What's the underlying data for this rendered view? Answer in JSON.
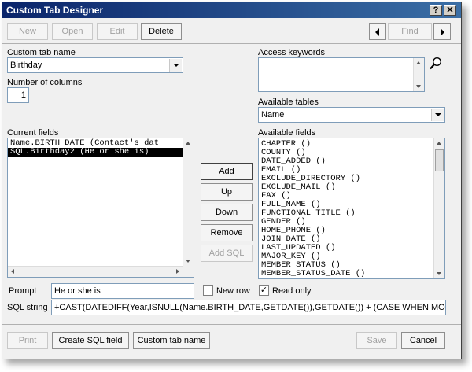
{
  "window": {
    "title": "Custom Tab Designer"
  },
  "titlebar": {
    "help_glyph": "?",
    "close_glyph": "✕"
  },
  "toolbar": {
    "new_label": "New",
    "open_label": "Open",
    "edit_label": "Edit",
    "delete_label": "Delete",
    "find_label": "Find"
  },
  "form": {
    "custom_tab_name_label": "Custom tab name",
    "custom_tab_name_value": "Birthday",
    "number_of_columns_label": "Number of columns",
    "number_of_columns_value": "1",
    "access_keywords_label": "Access keywords",
    "access_keywords_value": "",
    "available_tables_label": "Available tables",
    "available_tables_value": "Name",
    "current_fields_label": "Current fields",
    "available_fields_label": "Available fields",
    "prompt_label": "Prompt",
    "prompt_value": "He or she is",
    "new_row_label": "New row",
    "read_only_label": "Read only",
    "read_only_checked": "✓",
    "sql_string_label": "SQL string",
    "sql_string_value": "+CAST(DATEDIFF(Year,ISNULL(Name.BIRTH_DATE,GETDATE()),GETDATE()) + (CASE WHEN MONTH(G"
  },
  "current_fields": [
    {
      "text": "Name.BIRTH_DATE  (Contact's dat",
      "selected": false
    },
    {
      "text": "SQL.Birthday2  (He or she is)",
      "selected": true
    }
  ],
  "available_fields": [
    "CHAPTER ()",
    "COUNTY ()",
    "DATE_ADDED ()",
    "EMAIL ()",
    "EXCLUDE_DIRECTORY ()",
    "EXCLUDE_MAIL ()",
    "FAX ()",
    "FULL_NAME ()",
    "FUNCTIONAL_TITLE ()",
    "GENDER ()",
    "HOME_PHONE ()",
    "JOIN_DATE ()",
    "LAST_UPDATED ()",
    "MAJOR_KEY ()",
    "MEMBER_STATUS ()",
    "MEMBER_STATUS_DATE ()"
  ],
  "middle_buttons": {
    "add_label": "Add",
    "up_label": "Up",
    "down_label": "Down",
    "remove_label": "Remove",
    "add_sql_label": "Add SQL"
  },
  "footer": {
    "print_label": "Print",
    "create_sql_field_label": "Create SQL field",
    "custom_tab_name_label": "Custom tab name",
    "save_label": "Save",
    "cancel_label": "Cancel"
  }
}
